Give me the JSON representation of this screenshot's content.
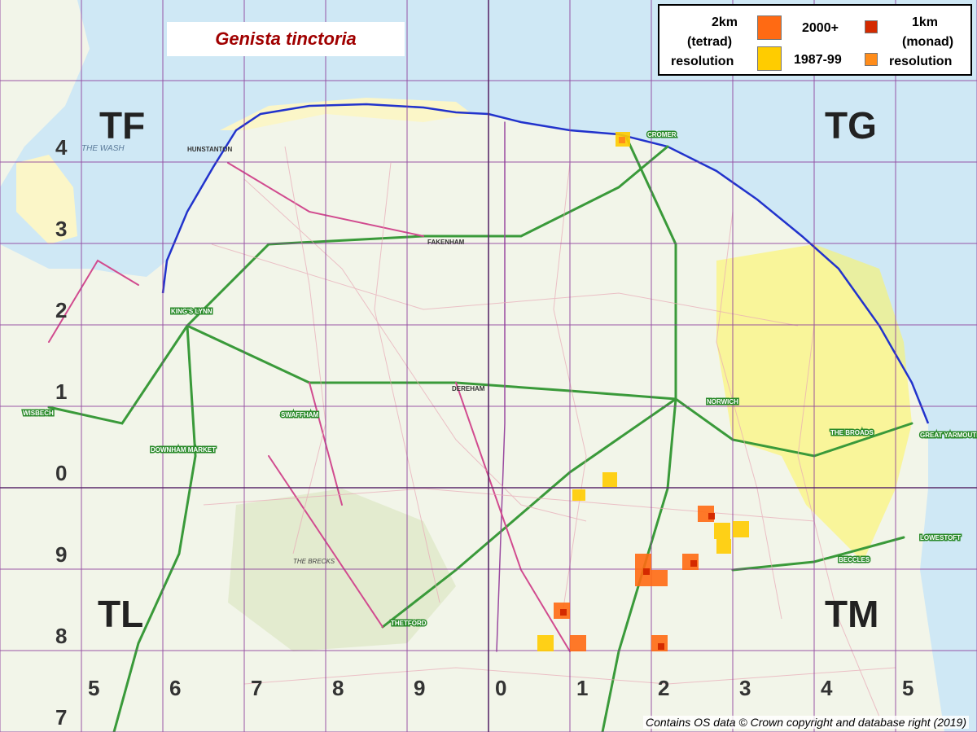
{
  "title": "Genista tinctoria",
  "legend": {
    "tetrad_label_1": "2km",
    "tetrad_label_2": "(tetrad)",
    "tetrad_label_3": "resolution",
    "period_recent": "2000+",
    "period_old": "1987-99",
    "monad_label_1": "1km",
    "monad_label_2": "(monad)",
    "monad_label_3": "resolution",
    "colors": {
      "tetrad_recent": "#ff6a13",
      "tetrad_old": "#ffcc00",
      "monad_recent": "#d42a00",
      "monad_old": "#ff8c1a"
    }
  },
  "grid_squares": {
    "TF": "TF",
    "TG": "TG",
    "TL": "TL",
    "TM": "TM"
  },
  "easting_labels": [
    "5",
    "6",
    "7",
    "8",
    "9",
    "0",
    "1",
    "2",
    "3",
    "4",
    "5"
  ],
  "northing_labels": [
    "4",
    "3",
    "2",
    "1",
    "0",
    "9",
    "8",
    "7"
  ],
  "place_labels": {
    "hunstanton": "HUNSTANTON",
    "kings_lynn": "KING'S LYNN",
    "fakenham": "FAKENHAM",
    "cromer": "CROMER",
    "norwich": "NORWICH",
    "dereham": "DEREHAM",
    "swaffham": "SWAFFHAM",
    "thetford": "THETFORD",
    "wisbech": "WISBECH",
    "downham_market": "DOWNHAM MARKET",
    "great_yarmouth": "GREAT YARMOUTH",
    "lowestoft": "LOWESTOFT",
    "beccles": "BECCLES",
    "the_broads": "THE BROADS",
    "the_wash": "THE WASH",
    "the_brecks": "THE BRECKS"
  },
  "records": [
    {
      "type": "tetrad",
      "period": "2000+",
      "easting": "TG25",
      "northing_cell": "4"
    },
    {
      "type": "tetrad",
      "period": "1987-99",
      "easting": "TM19",
      "northing_cell": "0"
    },
    {
      "type": "tetrad",
      "period": "2000+",
      "easting": "TM29",
      "northing_cell": "9"
    },
    {
      "type": "tetrad",
      "period": "2000+",
      "easting": "TM18",
      "northing_cell": "8"
    }
  ],
  "credit": "Contains OS data © Crown copyright and database right (2019)"
}
